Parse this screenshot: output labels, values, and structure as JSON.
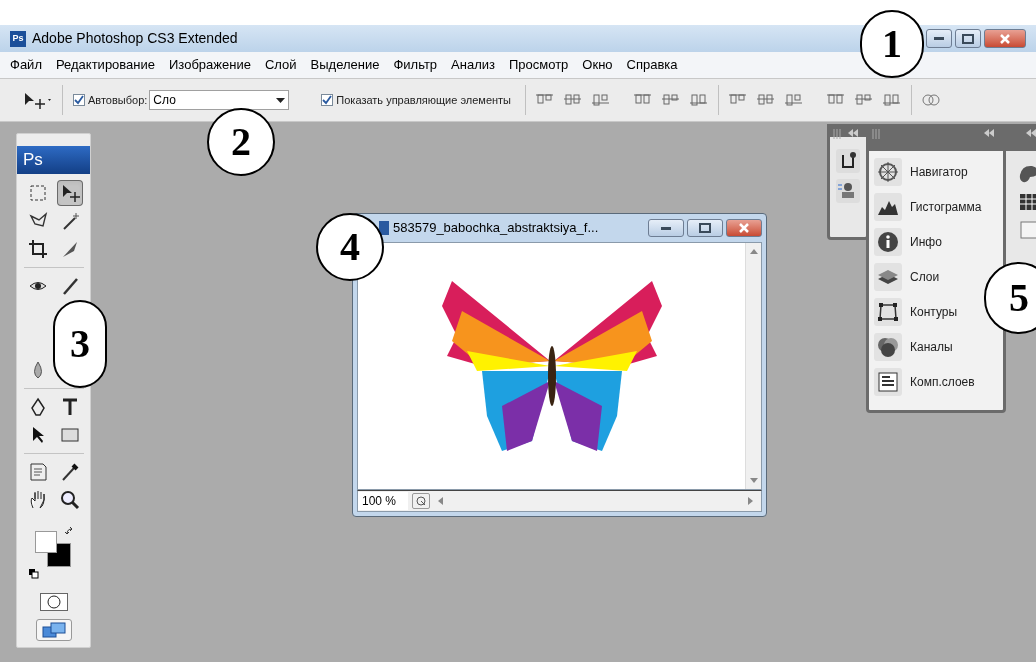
{
  "window": {
    "logo": "Ps",
    "title": "Adobe Photoshop CS3 Extended"
  },
  "menu": [
    "Файл",
    "Редактирование",
    "Изображение",
    "Слой",
    "Выделение",
    "Фильтр",
    "Анализ",
    "Просмотр",
    "Окно",
    "Справка"
  ],
  "options_bar": {
    "auto_select": {
      "label": "Автовыбор:",
      "checked": true
    },
    "auto_select_target": {
      "value": "Сло"
    },
    "show_controls": {
      "label": "Показать управляющие элементы",
      "checked": true
    }
  },
  "toolbox": {
    "logo": "Ps",
    "tools": [
      {
        "kind": "marquee",
        "selected": false
      },
      {
        "kind": "move",
        "selected": true
      },
      {
        "kind": "lasso",
        "selected": false
      },
      {
        "kind": "wand",
        "selected": false
      },
      {
        "kind": "crop",
        "selected": false
      },
      {
        "kind": "slice",
        "selected": false
      },
      {
        "kind": "eye",
        "selected": false
      },
      {
        "kind": "brush",
        "selected": false
      },
      {
        "kind": "covered"
      },
      {
        "kind": "covered"
      },
      {
        "kind": "covered"
      },
      {
        "kind": "covered"
      },
      {
        "kind": "drop",
        "selected": false
      },
      {
        "kind": "covered"
      },
      {
        "kind": "pen",
        "selected": false
      },
      {
        "kind": "type",
        "selected": false
      },
      {
        "kind": "arrow",
        "selected": false
      },
      {
        "kind": "rect",
        "selected": false
      },
      {
        "kind": "note",
        "selected": false
      },
      {
        "kind": "eyedropper",
        "selected": false
      },
      {
        "kind": "hand",
        "selected": false
      },
      {
        "kind": "zoom",
        "selected": false
      }
    ]
  },
  "document": {
    "title": "583579_babochka_abstraktsiya_f...",
    "zoom": "100 %"
  },
  "panels": {
    "items": [
      "Навигатор",
      "Гистограмма",
      "Инфо",
      "Слои",
      "Контуры",
      "Каналы",
      "Комп.слоев"
    ]
  },
  "callouts": [
    "1",
    "2",
    "3",
    "4",
    "5"
  ]
}
